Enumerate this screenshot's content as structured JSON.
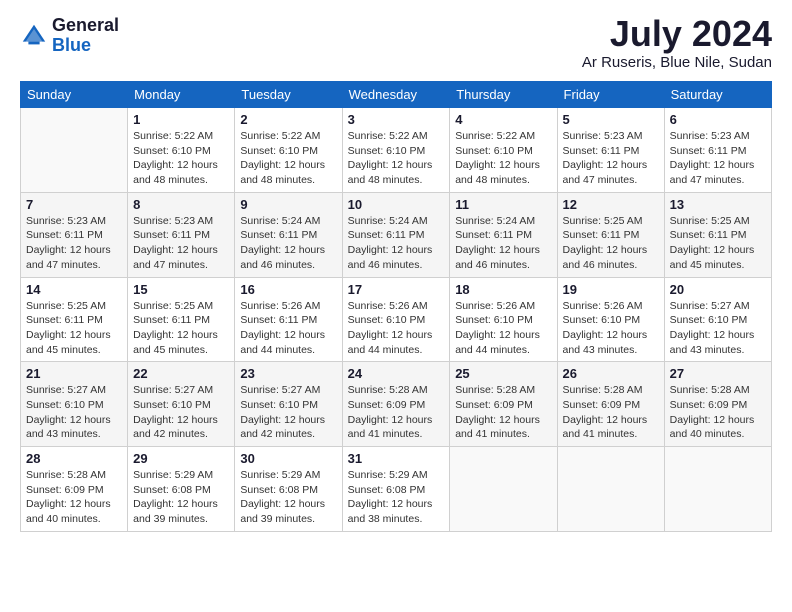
{
  "logo": {
    "line1": "General",
    "line2": "Blue"
  },
  "title": {
    "month_year": "July 2024",
    "location": "Ar Ruseris, Blue Nile, Sudan"
  },
  "days_of_week": [
    "Sunday",
    "Monday",
    "Tuesday",
    "Wednesday",
    "Thursday",
    "Friday",
    "Saturday"
  ],
  "weeks": [
    [
      {
        "day": "",
        "info": ""
      },
      {
        "day": "1",
        "info": "Sunrise: 5:22 AM\nSunset: 6:10 PM\nDaylight: 12 hours\nand 48 minutes."
      },
      {
        "day": "2",
        "info": "Sunrise: 5:22 AM\nSunset: 6:10 PM\nDaylight: 12 hours\nand 48 minutes."
      },
      {
        "day": "3",
        "info": "Sunrise: 5:22 AM\nSunset: 6:10 PM\nDaylight: 12 hours\nand 48 minutes."
      },
      {
        "day": "4",
        "info": "Sunrise: 5:22 AM\nSunset: 6:10 PM\nDaylight: 12 hours\nand 48 minutes."
      },
      {
        "day": "5",
        "info": "Sunrise: 5:23 AM\nSunset: 6:11 PM\nDaylight: 12 hours\nand 47 minutes."
      },
      {
        "day": "6",
        "info": "Sunrise: 5:23 AM\nSunset: 6:11 PM\nDaylight: 12 hours\nand 47 minutes."
      }
    ],
    [
      {
        "day": "7",
        "info": "Sunrise: 5:23 AM\nSunset: 6:11 PM\nDaylight: 12 hours\nand 47 minutes."
      },
      {
        "day": "8",
        "info": "Sunrise: 5:23 AM\nSunset: 6:11 PM\nDaylight: 12 hours\nand 47 minutes."
      },
      {
        "day": "9",
        "info": "Sunrise: 5:24 AM\nSunset: 6:11 PM\nDaylight: 12 hours\nand 46 minutes."
      },
      {
        "day": "10",
        "info": "Sunrise: 5:24 AM\nSunset: 6:11 PM\nDaylight: 12 hours\nand 46 minutes."
      },
      {
        "day": "11",
        "info": "Sunrise: 5:24 AM\nSunset: 6:11 PM\nDaylight: 12 hours\nand 46 minutes."
      },
      {
        "day": "12",
        "info": "Sunrise: 5:25 AM\nSunset: 6:11 PM\nDaylight: 12 hours\nand 46 minutes."
      },
      {
        "day": "13",
        "info": "Sunrise: 5:25 AM\nSunset: 6:11 PM\nDaylight: 12 hours\nand 45 minutes."
      }
    ],
    [
      {
        "day": "14",
        "info": "Sunrise: 5:25 AM\nSunset: 6:11 PM\nDaylight: 12 hours\nand 45 minutes."
      },
      {
        "day": "15",
        "info": "Sunrise: 5:25 AM\nSunset: 6:11 PM\nDaylight: 12 hours\nand 45 minutes."
      },
      {
        "day": "16",
        "info": "Sunrise: 5:26 AM\nSunset: 6:11 PM\nDaylight: 12 hours\nand 44 minutes."
      },
      {
        "day": "17",
        "info": "Sunrise: 5:26 AM\nSunset: 6:10 PM\nDaylight: 12 hours\nand 44 minutes."
      },
      {
        "day": "18",
        "info": "Sunrise: 5:26 AM\nSunset: 6:10 PM\nDaylight: 12 hours\nand 44 minutes."
      },
      {
        "day": "19",
        "info": "Sunrise: 5:26 AM\nSunset: 6:10 PM\nDaylight: 12 hours\nand 43 minutes."
      },
      {
        "day": "20",
        "info": "Sunrise: 5:27 AM\nSunset: 6:10 PM\nDaylight: 12 hours\nand 43 minutes."
      }
    ],
    [
      {
        "day": "21",
        "info": "Sunrise: 5:27 AM\nSunset: 6:10 PM\nDaylight: 12 hours\nand 43 minutes."
      },
      {
        "day": "22",
        "info": "Sunrise: 5:27 AM\nSunset: 6:10 PM\nDaylight: 12 hours\nand 42 minutes."
      },
      {
        "day": "23",
        "info": "Sunrise: 5:27 AM\nSunset: 6:10 PM\nDaylight: 12 hours\nand 42 minutes."
      },
      {
        "day": "24",
        "info": "Sunrise: 5:28 AM\nSunset: 6:09 PM\nDaylight: 12 hours\nand 41 minutes."
      },
      {
        "day": "25",
        "info": "Sunrise: 5:28 AM\nSunset: 6:09 PM\nDaylight: 12 hours\nand 41 minutes."
      },
      {
        "day": "26",
        "info": "Sunrise: 5:28 AM\nSunset: 6:09 PM\nDaylight: 12 hours\nand 41 minutes."
      },
      {
        "day": "27",
        "info": "Sunrise: 5:28 AM\nSunset: 6:09 PM\nDaylight: 12 hours\nand 40 minutes."
      }
    ],
    [
      {
        "day": "28",
        "info": "Sunrise: 5:28 AM\nSunset: 6:09 PM\nDaylight: 12 hours\nand 40 minutes."
      },
      {
        "day": "29",
        "info": "Sunrise: 5:29 AM\nSunset: 6:08 PM\nDaylight: 12 hours\nand 39 minutes."
      },
      {
        "day": "30",
        "info": "Sunrise: 5:29 AM\nSunset: 6:08 PM\nDaylight: 12 hours\nand 39 minutes."
      },
      {
        "day": "31",
        "info": "Sunrise: 5:29 AM\nSunset: 6:08 PM\nDaylight: 12 hours\nand 38 minutes."
      },
      {
        "day": "",
        "info": ""
      },
      {
        "day": "",
        "info": ""
      },
      {
        "day": "",
        "info": ""
      }
    ]
  ]
}
